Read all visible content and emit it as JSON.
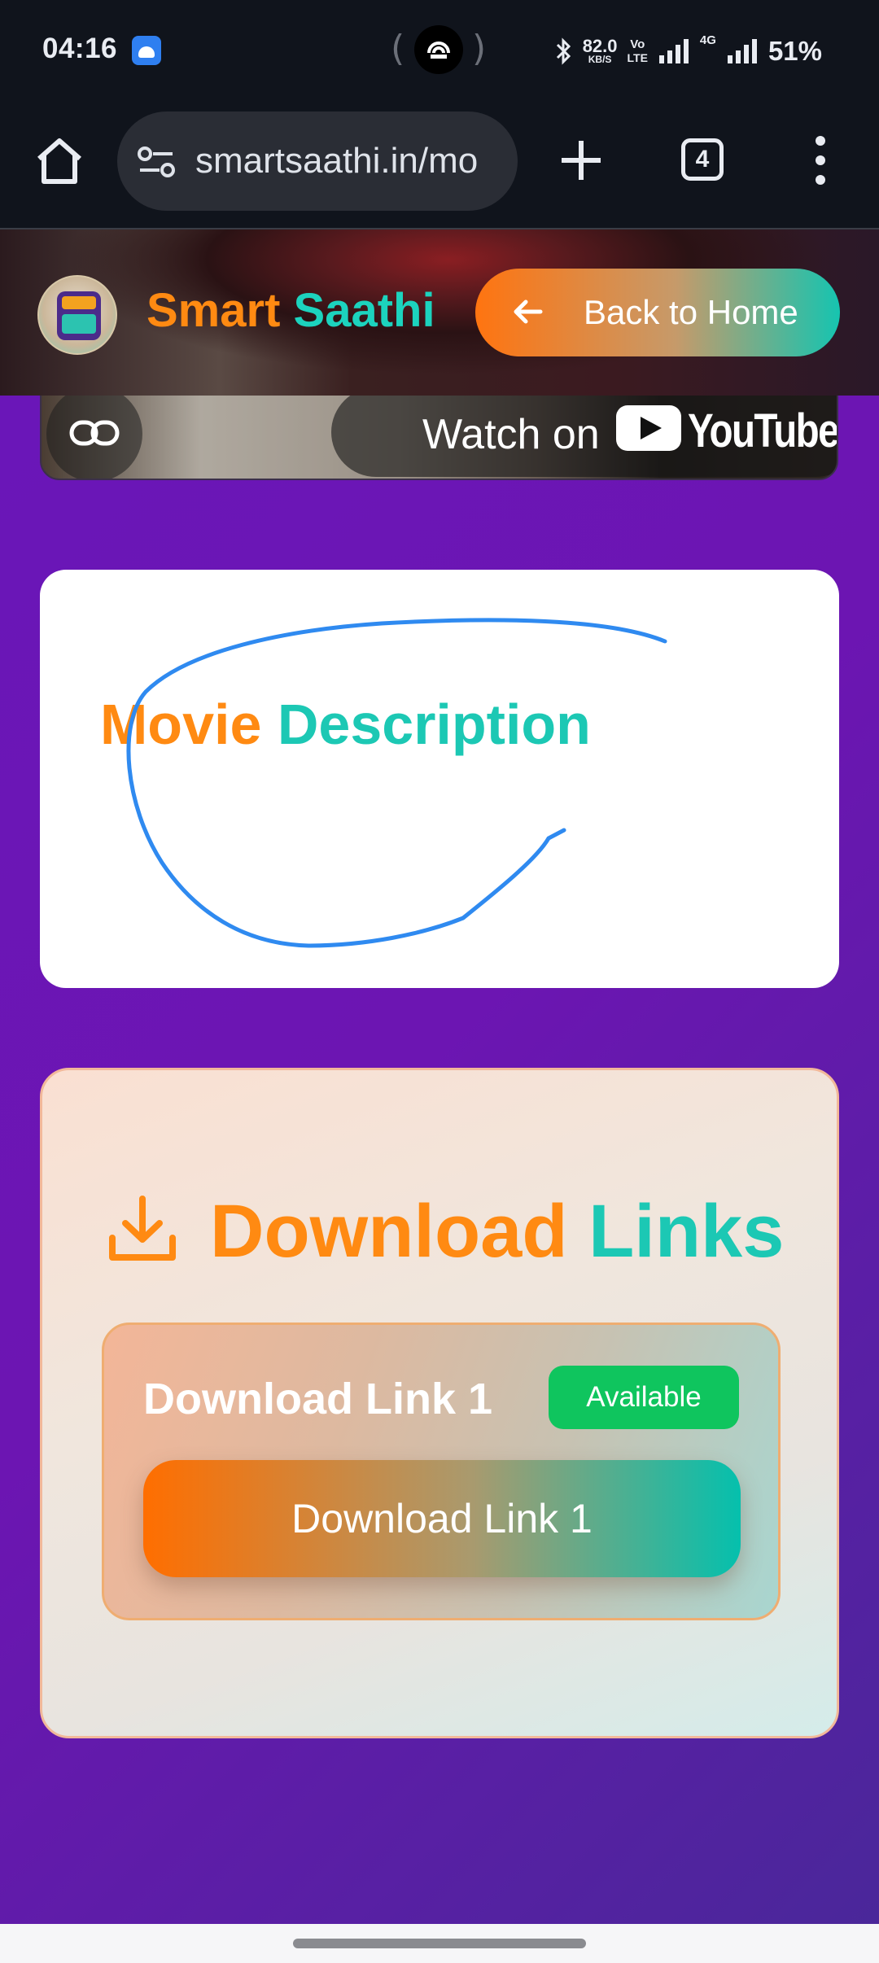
{
  "status_bar": {
    "time": "04:16",
    "net_speed": "82.0",
    "net_unit": "KB/S",
    "volte_top": "Vo",
    "volte_bottom": "LTE",
    "net_type": "4G",
    "battery": "51%"
  },
  "browser": {
    "url": "smartsaathi.in/mo",
    "tab_count": "4"
  },
  "header": {
    "brand_part1": "Smart",
    "brand_part2": "Saathi",
    "back_button": "Back to Home"
  },
  "video": {
    "watch_label": "Watch on",
    "youtube_label": "YouTube"
  },
  "description": {
    "title_part1": "Movie",
    "title_part2": "Description"
  },
  "downloads": {
    "title_part1": "Download",
    "title_part2": "Links",
    "items": [
      {
        "title": "Download Link 1",
        "status": "Available",
        "button_label": "Download Link 1"
      }
    ]
  },
  "colors": {
    "accent_orange": "#ff8a12",
    "accent_teal": "#1cc8b4",
    "background_purple": "#6a16b8",
    "badge_green": "#0fc55e",
    "annotation_blue": "#2f8af0"
  }
}
